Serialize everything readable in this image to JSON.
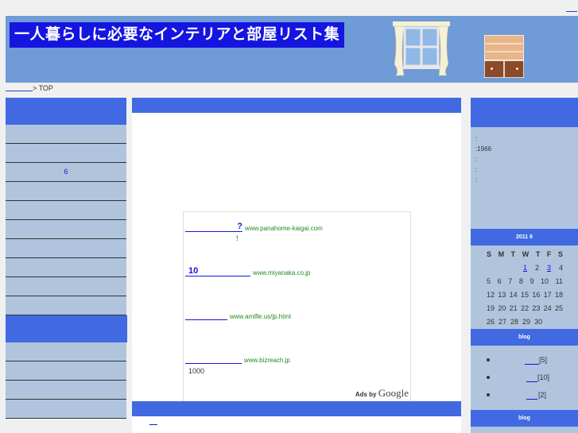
{
  "header": {
    "title": "一人暮らしに必要なインテリアと部屋リスト集"
  },
  "breadcrumb": {
    "separator": "> TOP"
  },
  "left_menu": {
    "items": [
      "",
      "",
      "6",
      "",
      "",
      "",
      "",
      "",
      "",
      ""
    ],
    "items2": [
      "",
      "",
      "",
      ""
    ]
  },
  "ads": {
    "items": [
      {
        "mark": "?",
        "url": "www.panahome-kaigai.com",
        "text": "!"
      },
      {
        "mark": "10",
        "url": "www.miyanaka.co.jp",
        "text": ""
      },
      {
        "mark": "",
        "url": "www.amifle.us/jp.html",
        "text": ""
      },
      {
        "mark": "",
        "url": "www.bizreach.jp",
        "text": "1000"
      }
    ],
    "ads_by": "Ads by",
    "google": "Google"
  },
  "profile": {
    "lines": [
      ":",
      ":1966",
      ":",
      ":",
      ":"
    ]
  },
  "calendar": {
    "title": "2011  6",
    "weekdays": [
      "S",
      "M",
      "T",
      "W",
      "T",
      "F",
      "S"
    ],
    "rows": [
      [
        "",
        "",
        "",
        "1",
        "2",
        "3",
        "4"
      ],
      [
        "5",
        "6",
        "7",
        "8",
        "9",
        "10",
        "11"
      ],
      [
        "12",
        "13",
        "14",
        "15",
        "16",
        "17",
        "18"
      ],
      [
        "19",
        "20",
        "21",
        "22",
        "23",
        "24",
        "25"
      ],
      [
        "26",
        "27",
        "28",
        "29",
        "30",
        "",
        ""
      ]
    ],
    "linked_days": [
      "1",
      "3"
    ]
  },
  "blog_section": {
    "title": "blog",
    "entries": [
      {
        "count": "[5]"
      },
      {
        "count": "[10]"
      },
      {
        "count": "[2]"
      }
    ]
  },
  "blog_section2": {
    "title": "blog"
  }
}
